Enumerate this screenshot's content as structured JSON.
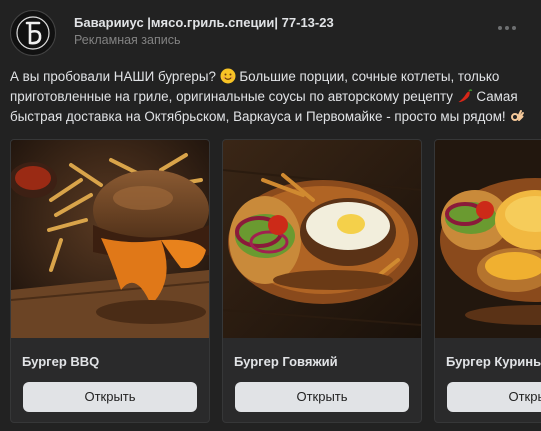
{
  "post": {
    "author": "Баварииус |мясо.гриль.специи| 77-13-23",
    "subtitle": "Рекламная запись",
    "text_before_emoji1": "А вы пробовали НАШИ бургеры? ",
    "text_mid1": " Большие порции, сочные котлеты, только приготовленные на гриле, оригинальные соусы по авторскому рецепту ",
    "text_mid2": " Самая быстрая доставка на Октябрьском, Варкауса и Первомайке - просто мы рядом! ",
    "icons": {
      "avatar": "bavarius-logo",
      "more": "more-horizontal-icon",
      "emoji1": "smiling-face-emoji",
      "emoji2": "hot-pepper-emoji",
      "emoji3": "ok-hand-emoji",
      "next": "chevron-right-icon"
    }
  },
  "cards": [
    {
      "title": "Бургер BBQ",
      "button": "Открыть"
    },
    {
      "title": "Бургер Говяжий",
      "button": "Открыть"
    },
    {
      "title": "Бургер Курины",
      "button": "Открыть"
    }
  ],
  "colors": {
    "background": "#222222",
    "card": "#2a2a2b",
    "button": "#e1e3e6",
    "text": "#e1e3e6",
    "muted": "#828282"
  }
}
